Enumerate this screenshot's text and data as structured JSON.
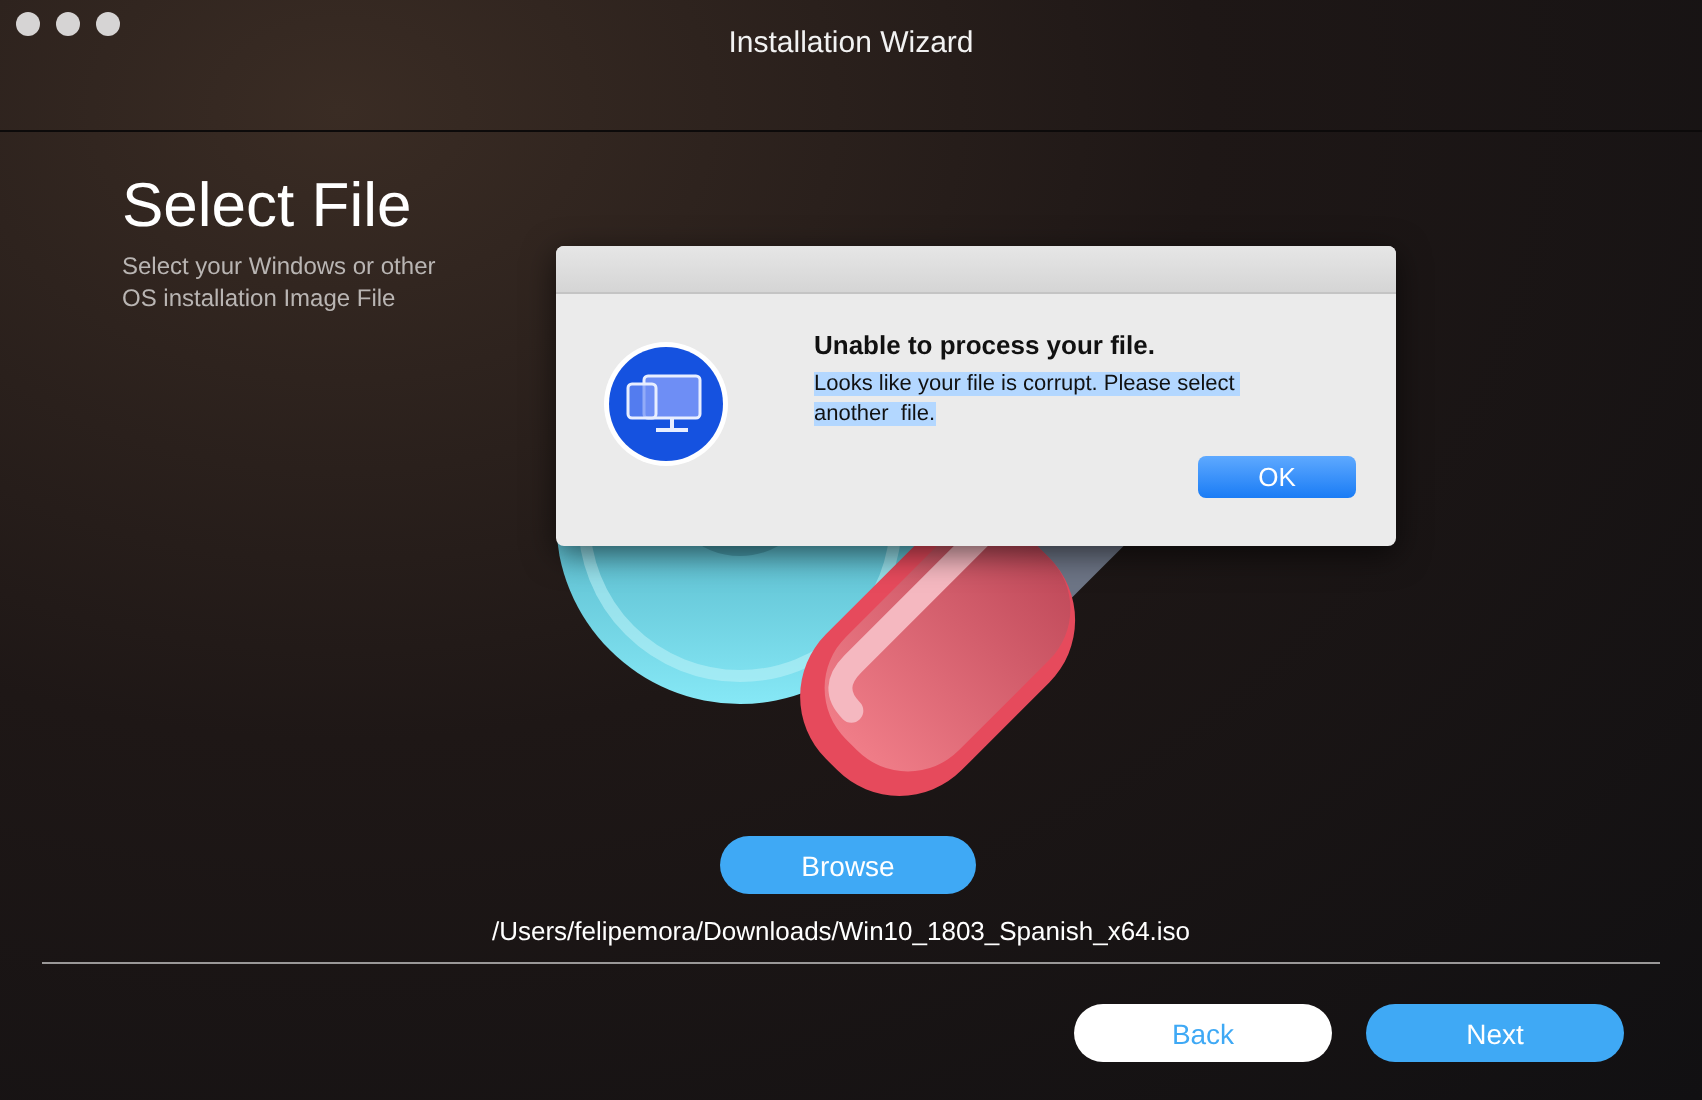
{
  "window": {
    "title": "Installation Wizard"
  },
  "step": {
    "title": "Select File",
    "subtitle": "Select your Windows or other OS installation Image File"
  },
  "illustration": {
    "kind": "disc-and-usb"
  },
  "browse_button": "Browse",
  "file_path": "/Users/felipemora/Downloads/Win10_1803_Spanish_x64.iso",
  "footer_buttons": [
    {
      "label": "Back",
      "kind": "secondary"
    },
    {
      "label": "Next",
      "kind": "primary"
    }
  ],
  "dialog": {
    "title": "Unable to process your file.",
    "message": "Looks like your file is corrupt. Please select another  file.",
    "message_selected": true,
    "button": "OK"
  }
}
